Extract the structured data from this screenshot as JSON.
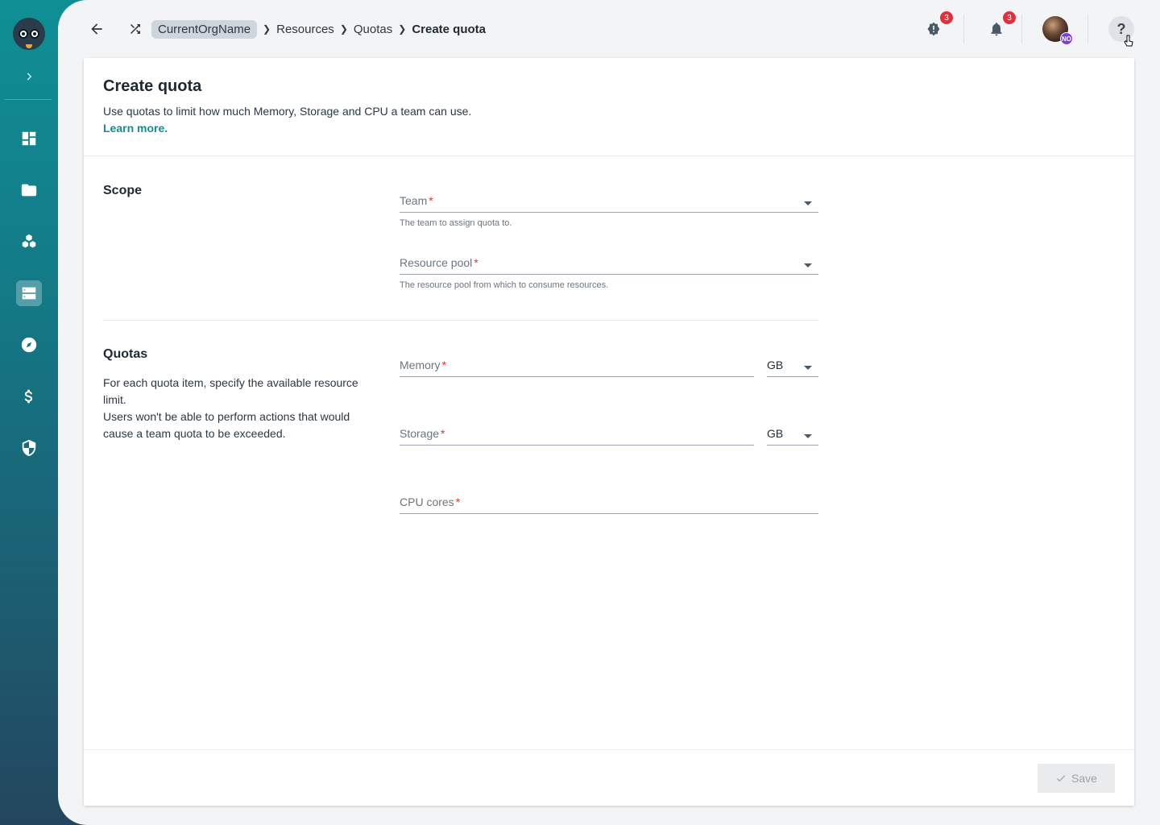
{
  "sidebar": {
    "expand_icon": "chevron-right-icon",
    "items": [
      {
        "name": "dashboard-icon",
        "active": false
      },
      {
        "name": "folder-icon",
        "active": false
      },
      {
        "name": "cluster-icon",
        "active": false
      },
      {
        "name": "server-icon",
        "active": true
      },
      {
        "name": "compass-icon",
        "active": false
      },
      {
        "name": "dollar-icon",
        "active": false
      },
      {
        "name": "shield-icon",
        "active": false
      }
    ]
  },
  "topbar": {
    "breadcrumb": {
      "org": "CurrentOrgName",
      "items": [
        "Resources",
        "Quotas"
      ],
      "current": "Create quota"
    },
    "alerts_count": "3",
    "notifications_count": "3",
    "avatar_initials": "NO",
    "help_label": "?"
  },
  "card": {
    "title": "Create quota",
    "description": "Use quotas to limit how much Memory, Storage and CPU a team can use.",
    "learn_more": "Learn more."
  },
  "scope": {
    "title": "Scope",
    "team_label": "Team",
    "team_helper": "The team to assign quota to.",
    "pool_label": "Resource pool",
    "pool_helper": "The resource pool from which to consume resources."
  },
  "quotas": {
    "title": "Quotas",
    "description_1": "For each quota item, specify the available resource limit.",
    "description_2": "Users won't be able to perform actions that would cause a team quota to be exceeded.",
    "memory_label": "Memory",
    "memory_unit": "GB",
    "storage_label": "Storage",
    "storage_unit": "GB",
    "cpu_label": "CPU cores"
  },
  "required_mark": "*",
  "footer": {
    "save_label": "Save"
  },
  "colors": {
    "accent": "#0f8f95",
    "required": "#e0303c",
    "badge": "#e0303c"
  }
}
